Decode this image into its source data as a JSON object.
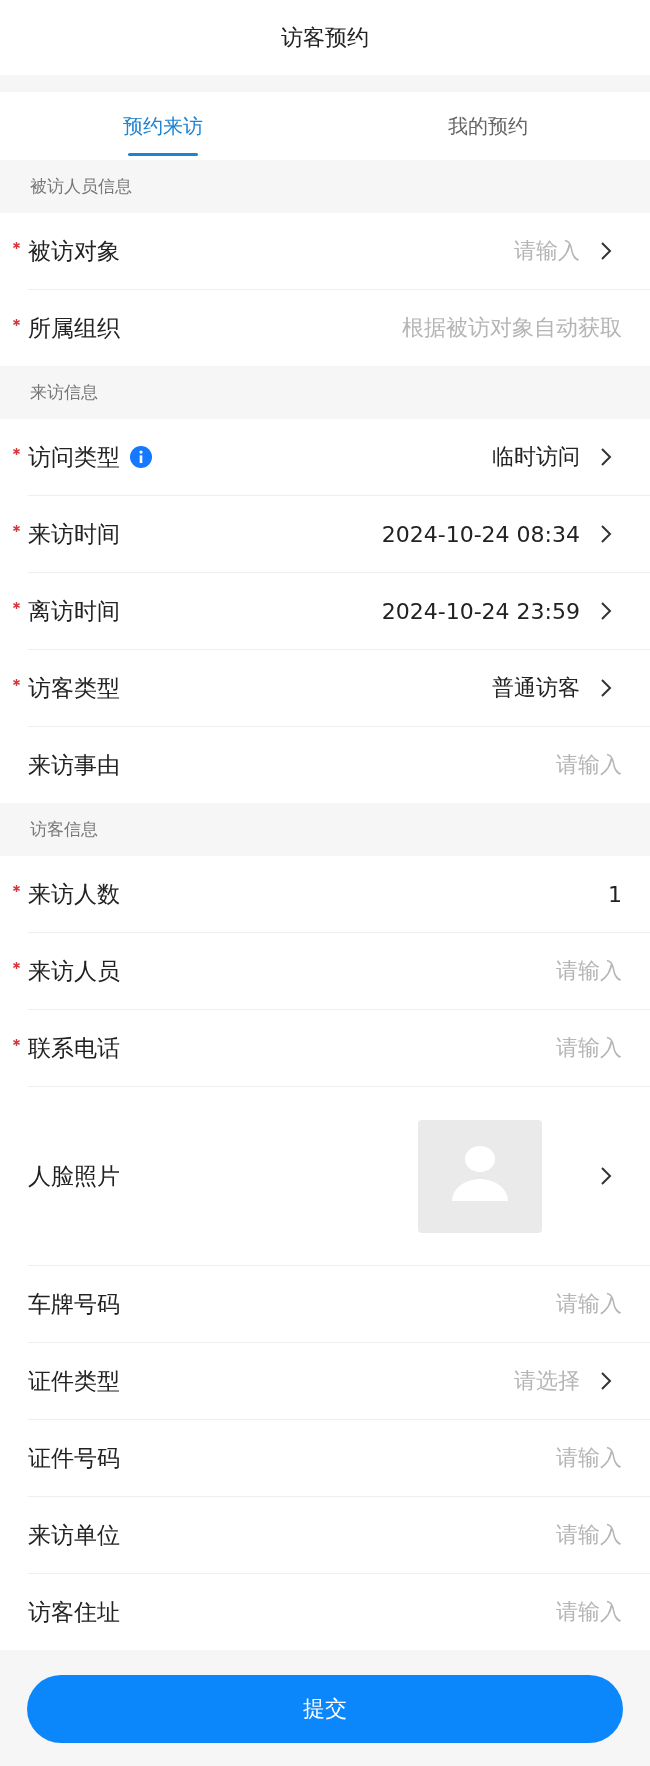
{
  "title": "访客预约",
  "tabs": [
    {
      "label": "预约来访",
      "selected": true
    },
    {
      "label": "我的预约",
      "selected": false
    }
  ],
  "sections": [
    {
      "heading": "被访人员信息",
      "rows": [
        {
          "kind": "field",
          "label": "被访对象",
          "required": true,
          "placeholder": "请输入",
          "arrow": true
        },
        {
          "kind": "field",
          "label": "所属组织",
          "required": true,
          "placeholder": "根据被访对象自动获取",
          "arrow": false
        }
      ]
    },
    {
      "heading": "来访信息",
      "rows": [
        {
          "kind": "field",
          "label": "访问类型",
          "required": true,
          "info": true,
          "value": "临时访问",
          "arrow": true
        },
        {
          "kind": "field",
          "label": "来访时间",
          "required": true,
          "value": "2024-10-24 08:34",
          "arrow": true
        },
        {
          "kind": "field",
          "label": "离访时间",
          "required": true,
          "value": "2024-10-24 23:59",
          "arrow": true
        },
        {
          "kind": "field",
          "label": "访客类型",
          "required": true,
          "value": "普通访客",
          "arrow": true
        },
        {
          "kind": "field",
          "label": "来访事由",
          "required": false,
          "placeholder": "请输入",
          "arrow": false
        }
      ]
    },
    {
      "heading": "访客信息",
      "rows": [
        {
          "kind": "field",
          "label": "来访人数",
          "required": true,
          "value": "1",
          "arrow": false
        },
        {
          "kind": "field",
          "label": "来访人员",
          "required": true,
          "placeholder": "请输入",
          "arrow": false
        },
        {
          "kind": "field",
          "label": "联系电话",
          "required": true,
          "placeholder": "请输入",
          "arrow": false
        },
        {
          "kind": "photo",
          "label": "人脸照片",
          "required": false,
          "arrow": true
        },
        {
          "kind": "field",
          "label": "车牌号码",
          "required": false,
          "placeholder": "请输入",
          "arrow": false
        },
        {
          "kind": "field",
          "label": "证件类型",
          "required": false,
          "placeholder": "请选择",
          "arrow": true
        },
        {
          "kind": "field",
          "label": "证件号码",
          "required": false,
          "placeholder": "请输入",
          "arrow": false
        },
        {
          "kind": "field",
          "label": "来访单位",
          "required": false,
          "placeholder": "请输入",
          "arrow": false
        },
        {
          "kind": "field",
          "label": "访客住址",
          "required": false,
          "placeholder": "请输入",
          "arrow": false
        }
      ]
    }
  ],
  "submit": "提交"
}
